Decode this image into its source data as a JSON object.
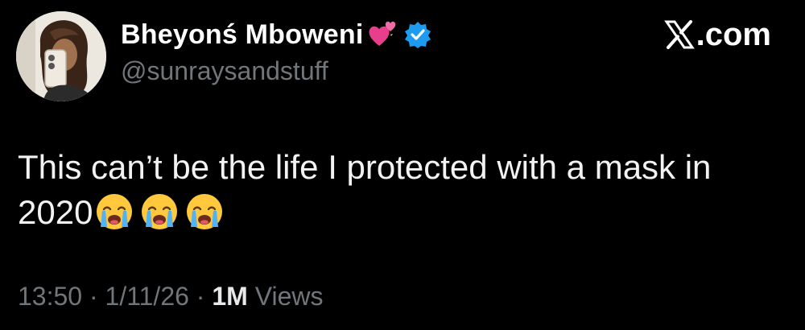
{
  "author": {
    "display_name": "Bheyonś Mboweni",
    "handle": "@sunraysandstuff",
    "verified": true,
    "name_emoji": "two-hearts-icon"
  },
  "brand": {
    "label": ".com",
    "logo": "x-logo-icon"
  },
  "tweet": {
    "text": "This can’t be the life I protected with a mask in 2020",
    "emojis": [
      "crying-face-icon",
      "crying-face-icon",
      "crying-face-icon"
    ]
  },
  "meta": {
    "time": "13:50",
    "separator": "·",
    "date": "1/11/26",
    "views_count": "1M",
    "views_label": "Views"
  },
  "colors": {
    "background": "#000000",
    "text": "#f2f2f2",
    "secondary": "#71767b",
    "verified": "#1d9bf0",
    "hearts": "#e83e8c"
  }
}
